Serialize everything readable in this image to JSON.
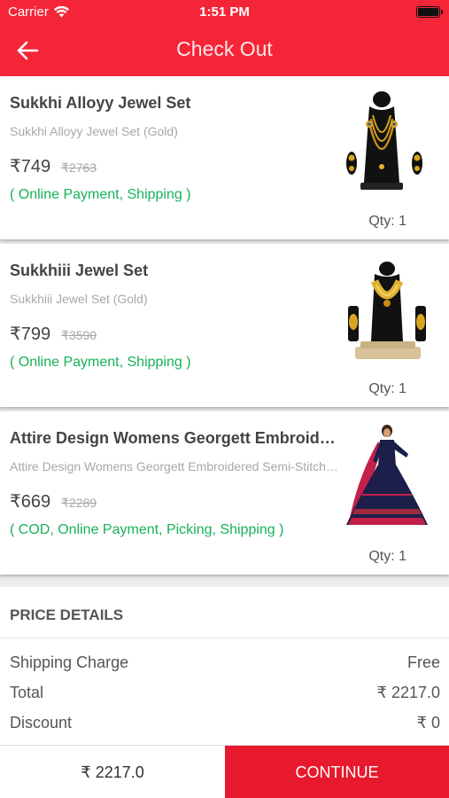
{
  "status_bar": {
    "carrier": "Carrier",
    "time": "1:51 PM"
  },
  "header": {
    "title": "Check Out"
  },
  "colors": {
    "brand": "#f52538",
    "continue": "#e8192c",
    "payment_mode": "#17b15a"
  },
  "products": [
    {
      "name": "Sukkhi Alloyy Jewel Set",
      "subname": "Sukkhi Alloyy Jewel Set  (Gold)",
      "price": "₹749",
      "mrp": "₹2763",
      "modes": "( Online Payment, Shipping )",
      "qty": "Qty: 1",
      "image": "necklace-set-image"
    },
    {
      "name": "Sukkhiii  Jewel Set",
      "subname": "Sukkhiii  Jewel Set  (Gold)",
      "price": "₹799",
      "mrp": "₹3590",
      "modes": "( Online Payment, Shipping )",
      "qty": "Qty: 1",
      "image": "gold-necklace-image"
    },
    {
      "name": "Attire Design Womens Georgett Embroidered Semi-Stitched",
      "subname": "Attire Design Womens Georgett Embroidered Semi-Stitched",
      "price": "₹669",
      "mrp": "₹2289",
      "modes": "( COD, Online Payment, Picking, Shipping )",
      "qty": "Qty: 1",
      "image": "anarkali-dress-image"
    }
  ],
  "price_details": {
    "heading": "PRICE DETAILS",
    "rows": [
      {
        "label": "Shipping Charge",
        "value": "Free"
      },
      {
        "label": "Total",
        "value": "₹ 2217.0"
      },
      {
        "label": "Discount",
        "value": "₹ 0"
      }
    ]
  },
  "bottom_bar": {
    "total": "₹ 2217.0",
    "continue_label": "CONTINUE"
  }
}
